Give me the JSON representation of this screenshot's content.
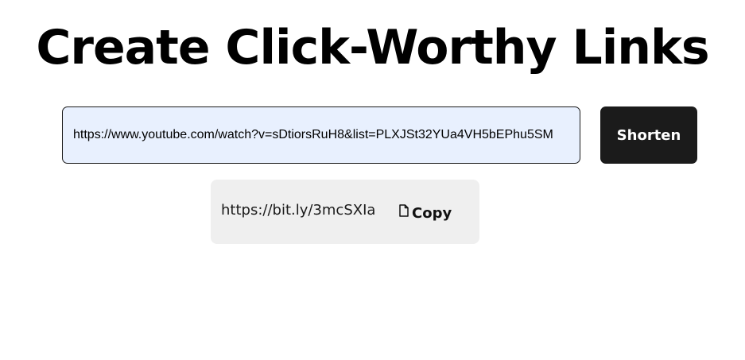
{
  "header": {
    "title": "Create Click-Worthy Links"
  },
  "form": {
    "url_value": "https://www.youtube.com/watch?v=sDtiorsRuH8&list=PLXJSt32YUa4VH5bEPhu5SM",
    "shorten_label": "Shorten"
  },
  "result": {
    "short_url": "https://bit.ly/3mcSXIa",
    "copy_label": "Copy",
    "copy_icon": "document-icon"
  },
  "colors": {
    "input_background": "#e8f0fe",
    "button_background": "#1b1b1b",
    "card_background": "#efefef"
  }
}
